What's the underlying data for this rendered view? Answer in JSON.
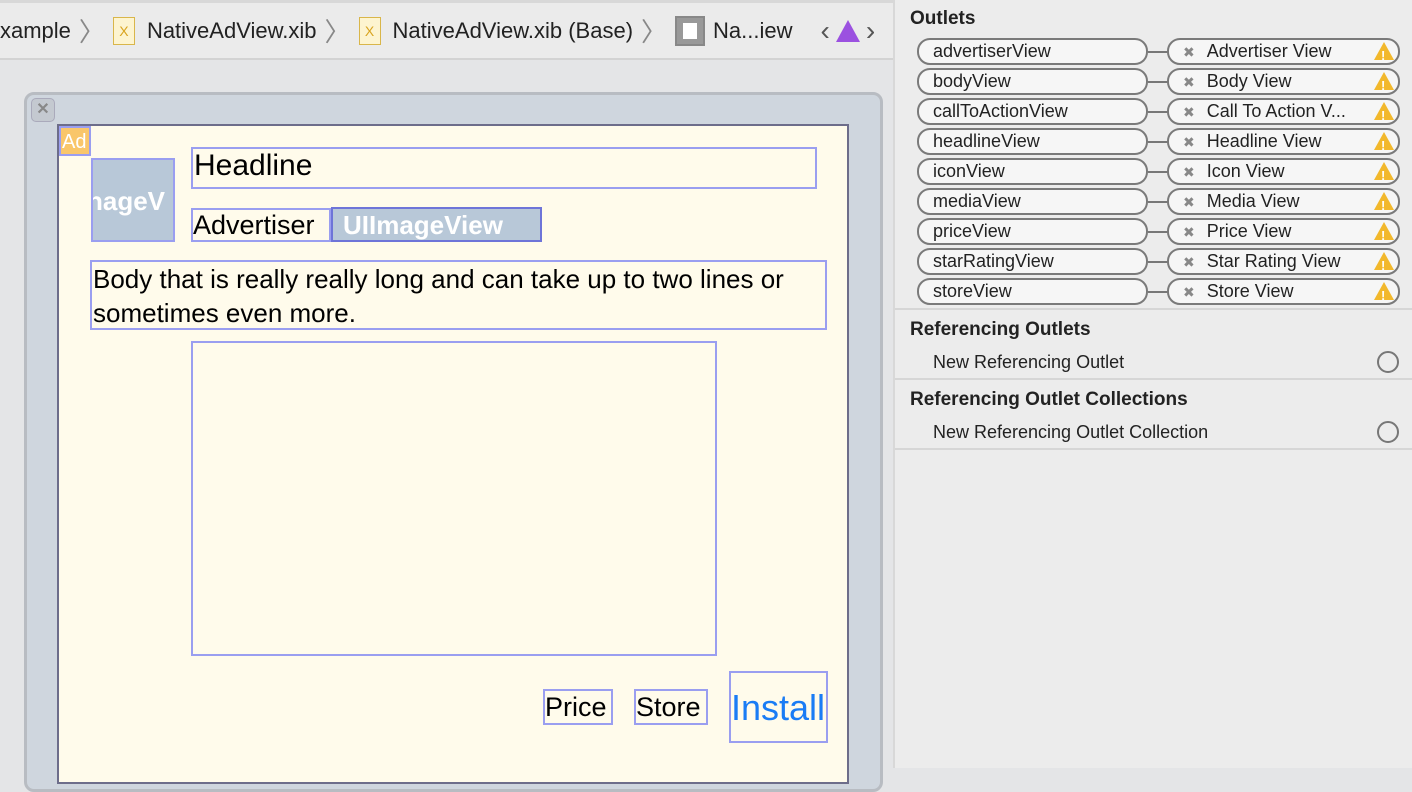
{
  "breadcrumb": {
    "items": [
      "xample",
      "NativeAdView.xib",
      "NativeAdView.xib (Base)",
      "Na...iew"
    ]
  },
  "canvas": {
    "ad_badge": "Ad",
    "icon_label": "nageV",
    "headline": "Headline",
    "advertiser": "Advertiser",
    "star_rating": "UIImageView",
    "body": "Body that is really really long and can take up to two lines or sometimes even more.",
    "price": "Price",
    "store": "Store",
    "install": "Install"
  },
  "inspector": {
    "outlets_title": "Outlets",
    "outlets": [
      {
        "name": "advertiserView",
        "target": "Advertiser View"
      },
      {
        "name": "bodyView",
        "target": "Body View"
      },
      {
        "name": "callToActionView",
        "target": "Call To Action V..."
      },
      {
        "name": "headlineView",
        "target": "Headline View"
      },
      {
        "name": "iconView",
        "target": "Icon View"
      },
      {
        "name": "mediaView",
        "target": "Media View"
      },
      {
        "name": "priceView",
        "target": "Price View"
      },
      {
        "name": "starRatingView",
        "target": "Star Rating View"
      },
      {
        "name": "storeView",
        "target": "Store View"
      }
    ],
    "referencing_title": "Referencing Outlets",
    "referencing_item": "New Referencing Outlet",
    "collections_title": "Referencing Outlet Collections",
    "collections_item": "New Referencing Outlet Collection"
  },
  "colors": {
    "install": "#1a7cf5",
    "warning": "#f2b82c",
    "issue": "#9b51e0",
    "outline": "#9a9ef0"
  }
}
